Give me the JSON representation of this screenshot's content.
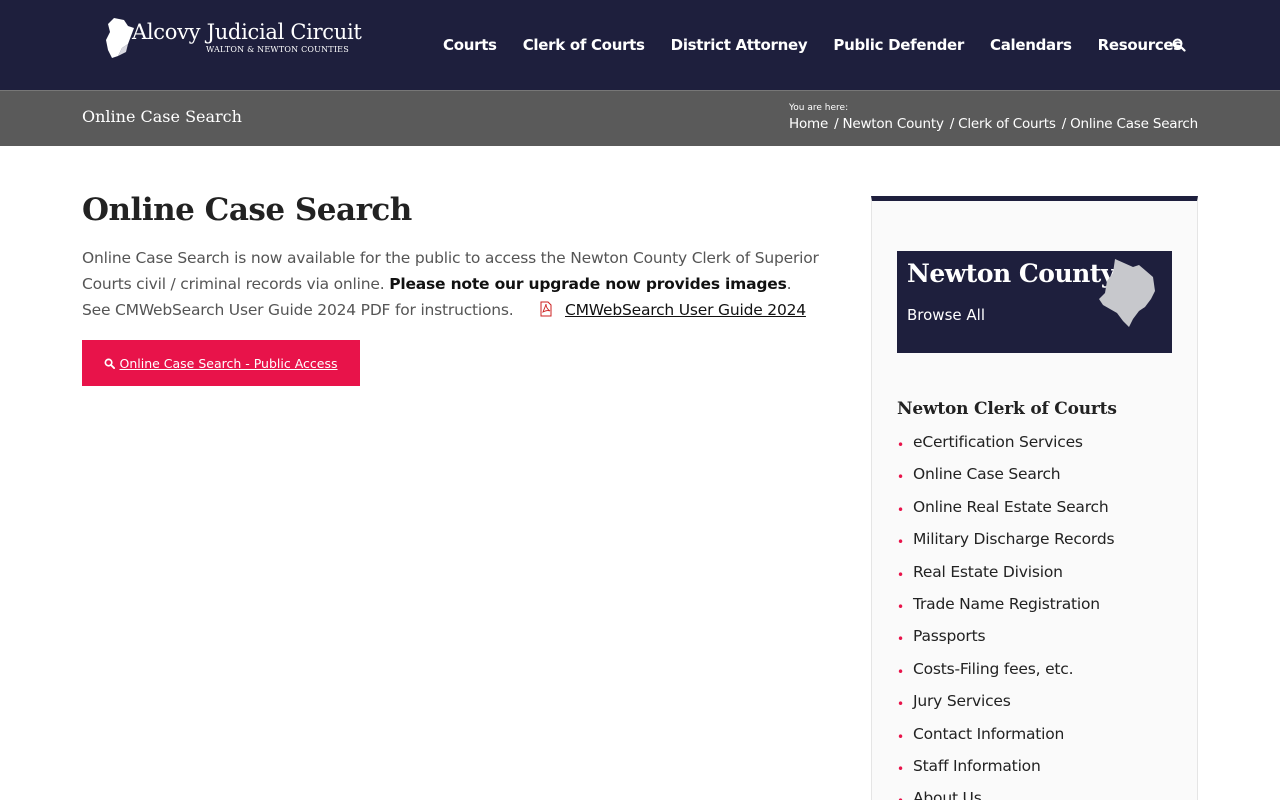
{
  "header": {
    "logo_title": "Alcovy Judicial Circuit",
    "logo_subtitle": "WALTON & NEWTON COUNTIES",
    "nav": [
      "Courts",
      "Clerk of Courts",
      "District Attorney",
      "Public Defender",
      "Calendars",
      "Resources"
    ],
    "search_icon": "search-icon"
  },
  "titlebar": {
    "title": "Online Case Search",
    "you_are_here": "You are here:",
    "breadcrumbs": [
      "Home",
      "Newton County",
      "Clerk of Courts",
      "Online Case Search"
    ],
    "separator": "/"
  },
  "main": {
    "title": "Online Case Search",
    "intro_text": "Online Case Search is now available for the public to access the Newton County Clerk of Superior Courts civil / criminal records via online. ",
    "intro_bold": "Please note our upgrade now provides images",
    "intro_after": ".  See CMWebSearch User Guide 2024 PDF for instructions.",
    "pdf_link": "CMWebSearch User Guide 2024",
    "button_label": "Online Case Search - Public Access"
  },
  "sidebar": {
    "county_title": "Newton County",
    "county_browse": "Browse All",
    "heading": "Newton Clerk of Courts",
    "items": [
      "eCertification Services",
      "Online Case Search",
      "Online Real Estate Search",
      "Military Discharge Records",
      "Real Estate Division",
      "Trade Name Registration",
      "Passports",
      "Costs-Filing fees, etc.",
      "Jury Services",
      "Contact Information",
      "Staff Information",
      "About Us"
    ]
  },
  "colors": {
    "navy": "#1e1f3d",
    "titlebar_gray": "#5a5a5a",
    "accent_red": "#e8134a"
  }
}
